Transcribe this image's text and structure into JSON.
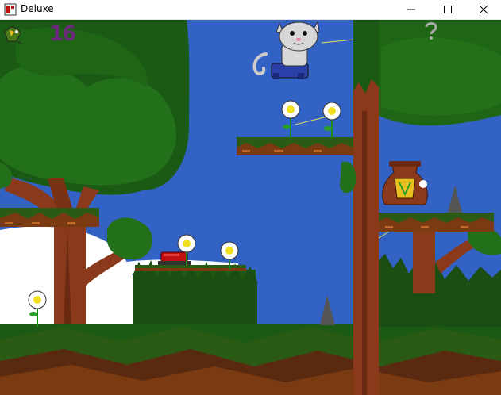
{
  "window": {
    "title": "Deluxe",
    "controls": {
      "minimize": "minimize-icon",
      "maximize": "maximize-icon",
      "close": "close-icon"
    }
  },
  "hud": {
    "score": "16",
    "life_icon": "bird-icon",
    "help_icon": "question-mark-icon"
  },
  "colors": {
    "sky": "#3060c0",
    "foliage": "#1a5a14",
    "bark": "#8a3a1a",
    "platform_grass": "#2a5a14",
    "platform_dirt": "#7a3a12",
    "cloud": "#ffffff",
    "score": "#6a2a7a",
    "button": "#c01010"
  }
}
